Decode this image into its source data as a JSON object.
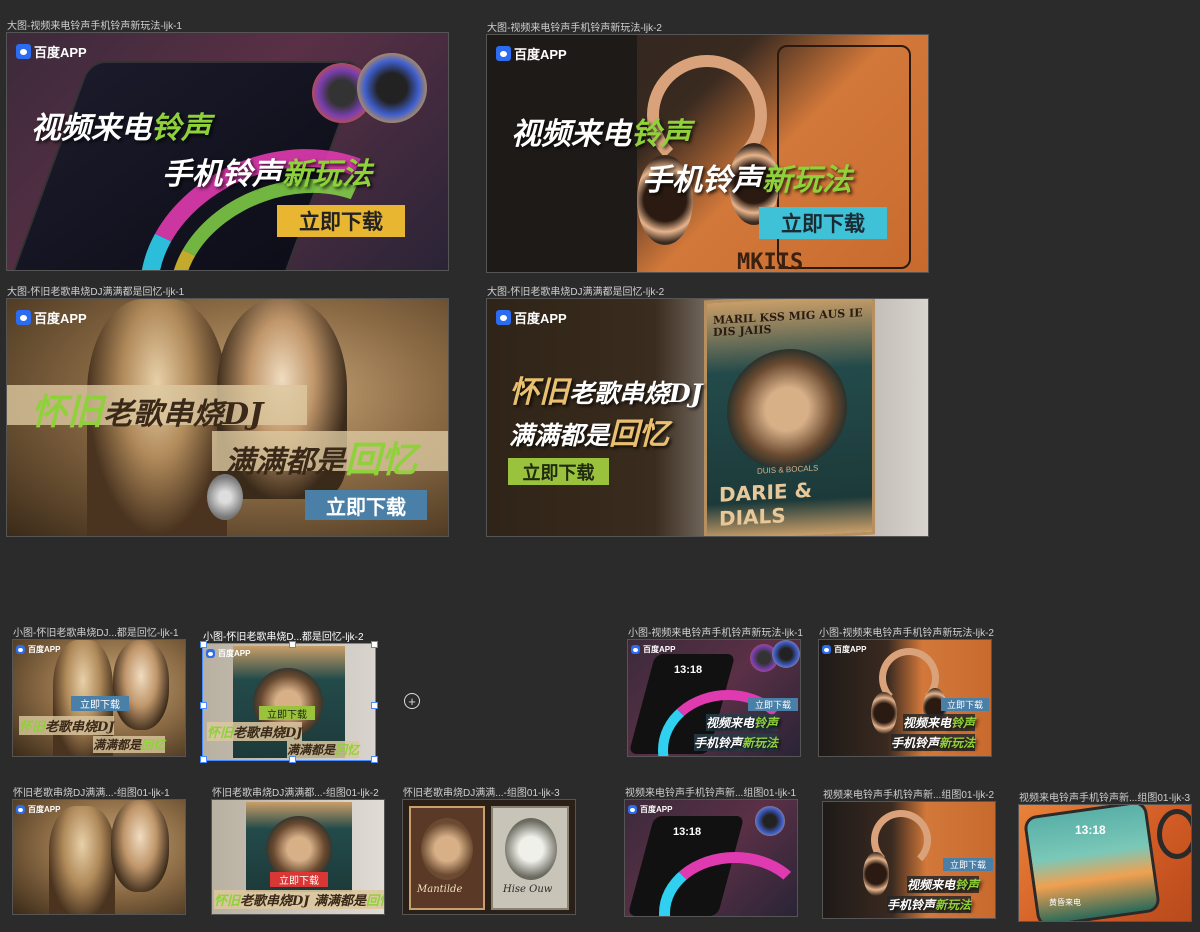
{
  "brand": "百度APP",
  "cta_label": "立即下载",
  "frames": {
    "big1": {
      "label": "大图-视频来电铃声手机铃声新玩法-ljk-1",
      "line1_a": "视频来电",
      "line1_b": "铃声",
      "line2_a": "手机铃声",
      "line2_b": "新玩法"
    },
    "big2": {
      "label": "大图-视频来电铃声手机铃声新玩法-ljk-2",
      "line1_a": "视频来电",
      "line1_b": "铃声",
      "line2_a": "手机铃声",
      "line2_b": "新玩法",
      "deco": "MKIIS"
    },
    "big3": {
      "label": "大图-怀旧老歌串烧DJ满满都是回忆-ljk-1",
      "line1_a": "怀旧",
      "line1_b": "老歌串烧DJ",
      "line2_a": "满满都是",
      "line2_b": "回忆"
    },
    "big4": {
      "label": "大图-怀旧老歌串烧DJ满满都是回忆-ljk-2",
      "line1_a": "怀旧",
      "line1_b": "老歌串烧DJ",
      "line2_a": "满满都是",
      "line2_b": "回忆",
      "poster_top": "MARIL KSS MIG AUS IE DIS JAIIS",
      "poster_title": "DARIE & DIALS",
      "poster_small": "DUIS & BOCALS"
    },
    "s1": {
      "label": "小图-怀旧老歌串烧DJ...都是回忆-ljk-1"
    },
    "s2": {
      "label": "小图-怀旧老歌串烧D...都是回忆-ljk-2"
    },
    "s3": {
      "label": "小图-视频来电铃声手机铃声新玩法-ljk-1",
      "clock": "13:18"
    },
    "s4": {
      "label": "小图-视频来电铃声手机铃声新玩法-ljk-2"
    },
    "g1": {
      "label": "怀旧老歌串烧DJ满满...-组图01-ljk-1"
    },
    "g2": {
      "label": "怀旧老歌串烧DJ满满都...-组图01-ljk-2",
      "line": "满满都是"
    },
    "g3": {
      "label": "怀旧老歌串烧DJ满满...-组图01-ljk-3",
      "sig1": "Mantilde",
      "sig2": "Hise Ouw"
    },
    "g4": {
      "label": "视频来电铃声手机铃声新...组图01-ljk-1",
      "clock": "13:18"
    },
    "g5": {
      "label": "视频来电铃声手机铃声新...组图01-ljk-2"
    },
    "g6": {
      "label": "视频来电铃声手机铃声新...组图01-ljk-3",
      "clock": "13:18",
      "caption": "黄昏来电"
    }
  },
  "colors": {
    "canvas": "#2b2b2b",
    "green": "#8fd13a",
    "gold_btn": "#e8b631",
    "cyan_btn": "#3fc2d8",
    "blue_btn": "#4a7fa8",
    "green_btn": "#9ac23c",
    "red_btn": "#d93636",
    "selection": "#4a8cff"
  },
  "icons": [
    "paw-logo-icon",
    "plus-circle-icon"
  ]
}
